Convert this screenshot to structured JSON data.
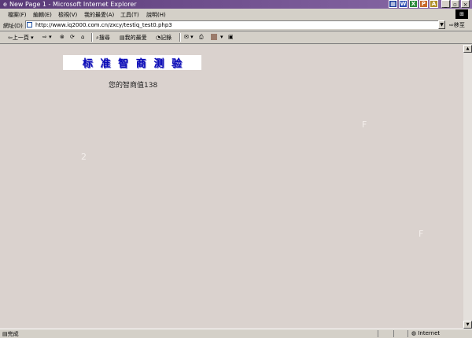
{
  "window": {
    "title": "New Page 1 - Microsoft Internet Explorer",
    "controls": [
      "_",
      "▫",
      "×"
    ]
  },
  "menu": {
    "items": [
      "檔案(F)",
      "編輯(E)",
      "檢視(V)",
      "我的最愛(A)",
      "工具(T)",
      "說明(H)"
    ]
  },
  "address": {
    "label": "網址(D)",
    "url": "http://www.iq2000.com.cn/zxcy/testiq_test0.php3",
    "go_label": "移至"
  },
  "toolbar": {
    "back": "上一頁",
    "search": "搜尋",
    "favorites": "我的最愛",
    "history": "記錄"
  },
  "page": {
    "banner_chars": [
      "标",
      "准",
      "智",
      "商",
      "测",
      "验"
    ],
    "iq_text": "您的智商值138",
    "ghost_chars": [
      "2",
      "F",
      "F"
    ]
  },
  "status": {
    "left": "完成",
    "zone": "Internet"
  }
}
